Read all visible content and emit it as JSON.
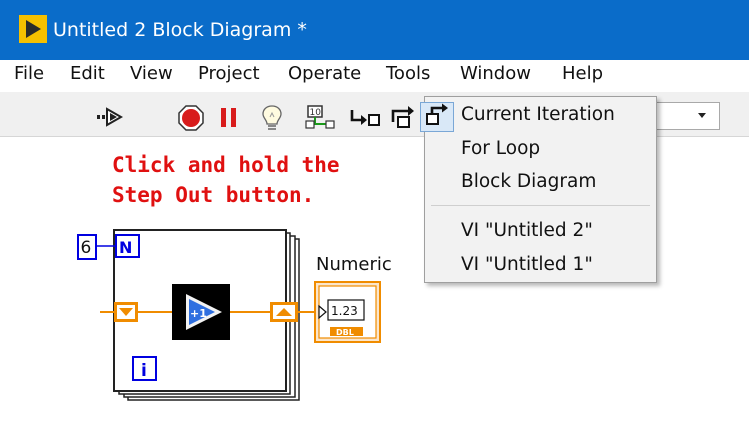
{
  "window": {
    "title": "Untitled 2 Block Diagram *",
    "titlebar_color": "#0a6cc9"
  },
  "menubar": {
    "items": [
      "File",
      "Edit",
      "View",
      "Project",
      "Operate",
      "Tools",
      "Window",
      "Help"
    ]
  },
  "toolbar": {
    "icons": [
      "run-icon",
      "abort-icon",
      "pause-icon",
      "highlight-execution-icon",
      "retain-wire-values-icon",
      "step-into-icon",
      "step-over-icon",
      "step-out-icon"
    ],
    "combo_value": ""
  },
  "instruction": {
    "line1": "Click and hold the",
    "line2": "Step Out button.",
    "color": "#e01010"
  },
  "step_out_menu": {
    "items": [
      "Current Iteration",
      "For Loop",
      "Block Diagram",
      "VI \"Untitled 2\"",
      "VI \"Untitled 1\""
    ]
  },
  "block_diagram": {
    "count_constant": "6",
    "count_terminal": "N",
    "iteration_terminal": "i",
    "increment_label": "+1",
    "indicator_label": "Numeric",
    "indicator_value": "1.23",
    "indicator_type": "DBL",
    "wire_color": "#f08c00",
    "terminal_color": "#0000e0"
  }
}
